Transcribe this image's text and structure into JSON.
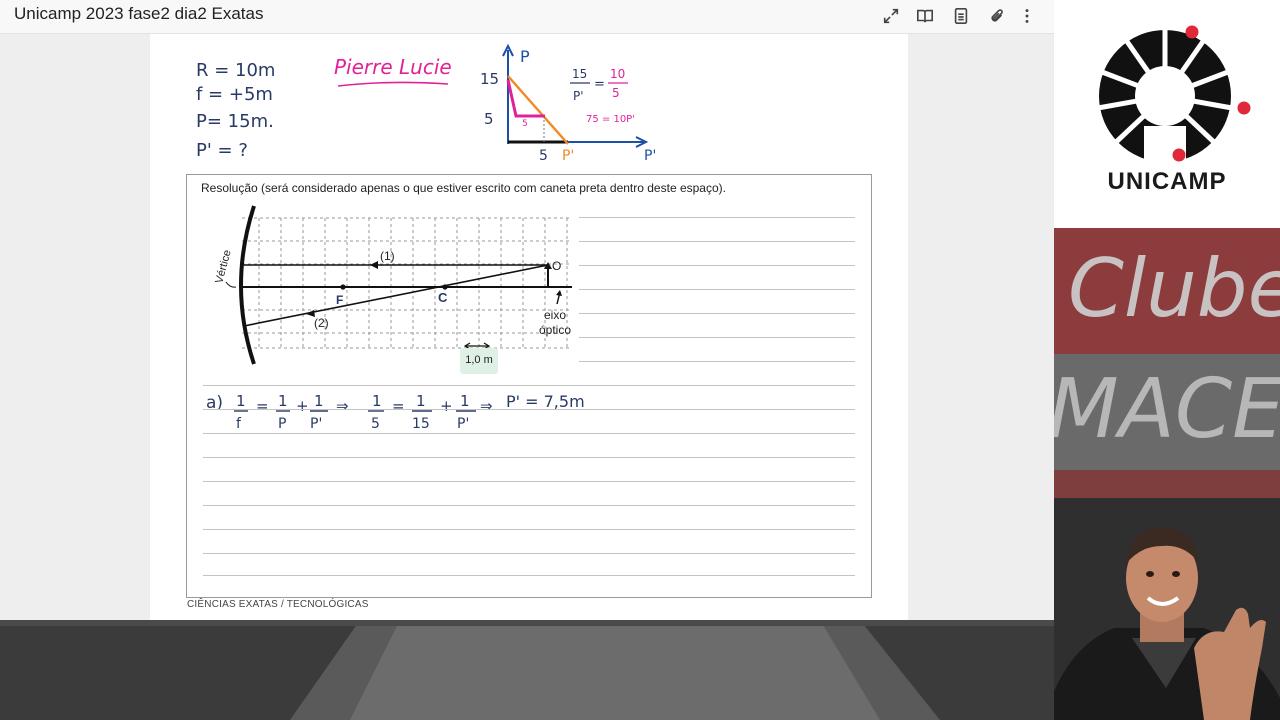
{
  "window": {
    "title": "Unicamp 2023 fase2 dia2 Exatas",
    "toolbar": [
      {
        "icon": "fullscreen-icon"
      },
      {
        "icon": "book-icon"
      },
      {
        "icon": "page-icon"
      },
      {
        "icon": "attach-icon"
      },
      {
        "icon": "more-icon"
      }
    ]
  },
  "notes": {
    "lines": [
      "R = 10m",
      "f = +5m",
      "P= 15m.",
      "P' = ?"
    ],
    "author": "Pierre Lucie",
    "graph": {
      "y_axis": "P",
      "x_axis": "P'",
      "y_ticks": [
        "15",
        "5"
      ],
      "x_tick": "5",
      "x_end": "P'",
      "inner_label": "5",
      "ratio_left_num": "15",
      "ratio_left_den": "P'",
      "ratio_right_num": "10",
      "ratio_right_den": "5",
      "equation": "75 = 10P'"
    }
  },
  "answer": {
    "instructions": "Resolução (será considerado apenas o que estiver escrito com caneta preta dentro deste espaço).",
    "diagram": {
      "vertex_label": "Vértice",
      "ray1_label": "(1)",
      "ray2_label": "(2)",
      "focus_label": "F",
      "center_label": "C",
      "object_label": "O",
      "axis_label_1": "eixo",
      "axis_label_2": "óptico",
      "scale_label": "1,0 m"
    },
    "solution": {
      "part": "a)",
      "result": "P' = 7,5m"
    }
  },
  "footer": "CIÊNCIAS EXATAS / TECNOLÓGICAS",
  "sidebar": {
    "logo_text": "UNICAMP",
    "banner1": "Clube",
    "banner2": "MACE"
  },
  "colors": {
    "magenta": "#e0229a",
    "orange": "#f08a24",
    "ink": "#2a3a66",
    "axis_blue": "#1e4fa8",
    "logo_red": "#e0283a"
  }
}
